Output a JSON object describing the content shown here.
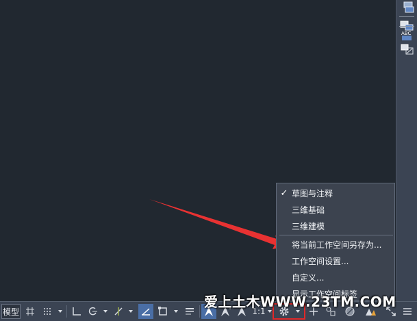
{
  "statusbar": {
    "model_tab": "模型",
    "scale": "1:1"
  },
  "workspace_menu": {
    "items": [
      {
        "label": "草图与注释",
        "checked": true
      },
      {
        "label": "三维基础",
        "checked": false
      },
      {
        "label": "三维建模",
        "checked": false
      },
      {
        "label": "将当前工作空间另存为...",
        "checked": false
      },
      {
        "label": "工作空间设置...",
        "checked": false
      },
      {
        "label": "自定义...",
        "checked": false
      },
      {
        "label": "显示工作空间标签",
        "checked": false
      }
    ],
    "check_glyph": "✓"
  },
  "right_toolbar": {
    "icons": [
      "layer-stack-icon",
      "layer-properties-icon",
      "text-style-icon",
      "layer-match-icon"
    ]
  },
  "watermark": "爱上土木WWW.23TM.COM",
  "colors": {
    "canvas": "#212830",
    "toolbar": "#3b4453",
    "menu": "#3c434f",
    "highlight": "#e02828",
    "accent": "#4a6ea5"
  }
}
